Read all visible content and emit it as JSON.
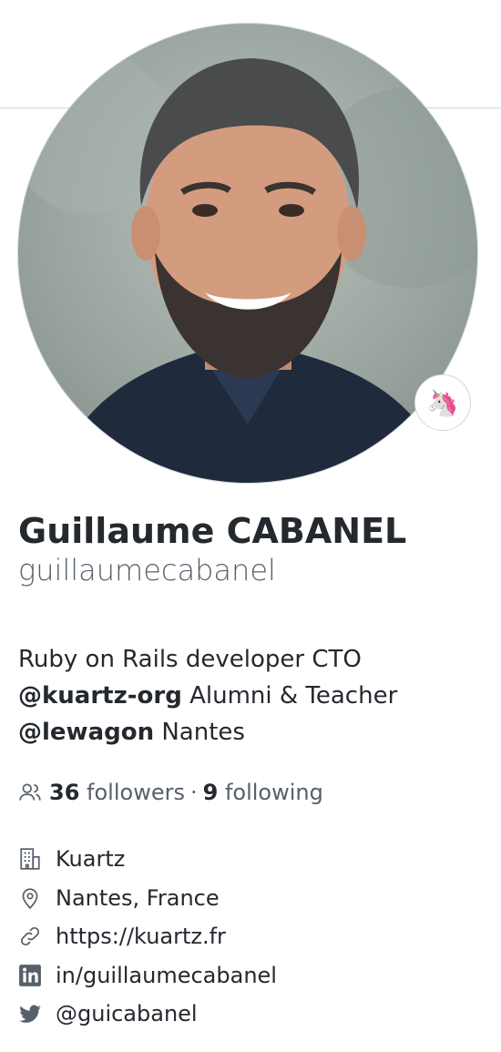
{
  "profile": {
    "fullname": "Guillaume CABANEL",
    "username": "guillaumecabanel",
    "status_emoji": "🦄",
    "bio": {
      "line1": "Ruby on Rails developer CTO",
      "org_mention": "@kuartz-org",
      "line2_rest": " Alumni & Teacher",
      "lewagon_mention": "@lewagon",
      "line3_rest": " Nantes"
    },
    "followers_count": "36",
    "followers_label": "followers",
    "separator": "·",
    "following_count": "9",
    "following_label": "following",
    "details": {
      "company": "Kuartz",
      "location": "Nantes, France",
      "website": "https://kuartz.fr",
      "linkedin": "in/guillaumecabanel",
      "twitter": "@guicabanel"
    }
  },
  "icons": {
    "people": "people-icon",
    "organization": "organization-icon",
    "location": "location-icon",
    "link": "link-icon",
    "linkedin": "linkedin-icon",
    "twitter": "twitter-icon"
  },
  "colors": {
    "text": "#24292f",
    "muted": "#57606a",
    "border": "#d0d7de",
    "shirt": "#1f2a3d"
  }
}
